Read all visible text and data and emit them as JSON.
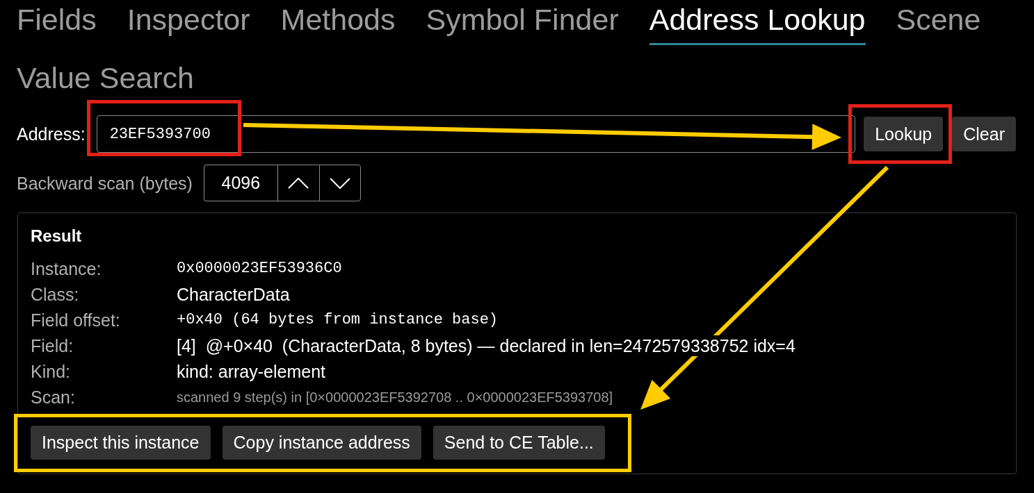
{
  "tabs": [
    {
      "label": "Fields",
      "selected": false
    },
    {
      "label": "Inspector",
      "selected": false
    },
    {
      "label": "Methods",
      "selected": false
    },
    {
      "label": "Symbol Finder",
      "selected": false
    },
    {
      "label": "Address Lookup",
      "selected": true
    },
    {
      "label": "Scene",
      "selected": false
    },
    {
      "label": "Value Search",
      "selected": false
    }
  ],
  "address": {
    "label": "Address:",
    "value": "23EF5393700"
  },
  "actions": [
    "Lookup",
    "Clear"
  ],
  "backward_scan": {
    "label": "Backward scan (bytes)",
    "value": "4096"
  },
  "result": {
    "title": "Result",
    "rows": [
      {
        "label": "Instance:",
        "value": "0x0000023EF53936C0",
        "kind": "mono"
      },
      {
        "label": "Class:",
        "value": "CharacterData",
        "kind": "text"
      },
      {
        "label": "Field offset:",
        "value": "+0x40 (64 bytes from instance base)",
        "kind": "mono"
      },
      {
        "label": "Field:",
        "value": "[4]  @+0×40  (CharacterData, 8 bytes) — declared in len=2472579338752 idx=4",
        "kind": "text"
      },
      {
        "label": "Kind:",
        "value": "kind: array-element",
        "kind": "text"
      },
      {
        "label": "Scan:",
        "value": "scanned 9 step(s) in [0×0000023EF5392708 .. 0×0000023EF5393708]",
        "kind": "note"
      }
    ],
    "buttons": [
      "Inspect this instance",
      "Copy instance address",
      "Send to CE Table..."
    ]
  },
  "annotations": [
    {
      "kind": "frame",
      "color": "#e32119"
    },
    {
      "kind": "frame",
      "color": "#e32119"
    },
    {
      "kind": "arrow",
      "color": "#ffcc00"
    },
    {
      "kind": "arrow",
      "color": "#ffcc00"
    },
    {
      "kind": "frame",
      "color": "#ffcc00"
    }
  ]
}
